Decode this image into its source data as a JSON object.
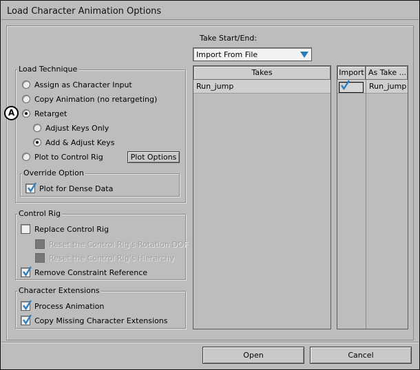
{
  "window": {
    "title": "Load Character Animation Options"
  },
  "take_start_end": {
    "label": "Take Start/End:",
    "dropdown_value": "Import From File"
  },
  "load_technique": {
    "label": "Load Technique",
    "options": {
      "assign": "Assign as Character Input",
      "copy": "Copy Animation (no retargeting)",
      "retarget": "Retarget",
      "adjust_keys_only": "Adjust Keys Only",
      "add_adjust_keys": "Add & Adjust Keys",
      "plot": "Plot to Control Rig"
    },
    "plot_options_button": "Plot Options",
    "selected": "retarget",
    "retarget_sub_selected": "add_adjust_keys",
    "badge": "A"
  },
  "override_option": {
    "label": "Override Option",
    "plot_dense": {
      "label": "Plot for Dense Data",
      "checked": true
    }
  },
  "control_rig": {
    "label": "Control Rig",
    "replace": {
      "label": "Replace Control Rig",
      "checked": false
    },
    "reset_rotation": {
      "label": "Reset the Control Rig's Rotation DOF",
      "checked": false,
      "enabled": false
    },
    "reset_hierarchy": {
      "label": "Reset the Control Rig's Hierarchy",
      "checked": false,
      "enabled": false
    },
    "remove_constraint": {
      "label": "Remove Constraint Reference",
      "checked": true
    }
  },
  "character_extensions": {
    "label": "Character Extensions",
    "process": {
      "label": "Process Animation",
      "checked": true
    },
    "copy_missing": {
      "label": "Copy Missing Character Extensions",
      "checked": true
    }
  },
  "takes_panel": {
    "header": "Takes",
    "rows": [
      "Run_jump"
    ]
  },
  "import_panel": {
    "headers": {
      "import": "Import",
      "as_take": "As Take ..."
    },
    "rows": [
      {
        "import": true,
        "as_take": "Run_jump"
      }
    ]
  },
  "buttons": {
    "open": "Open",
    "cancel": "Cancel"
  },
  "colors": {
    "dropdown_arrow": "#2a7ab8",
    "checkmark": "#2f7fbf"
  }
}
